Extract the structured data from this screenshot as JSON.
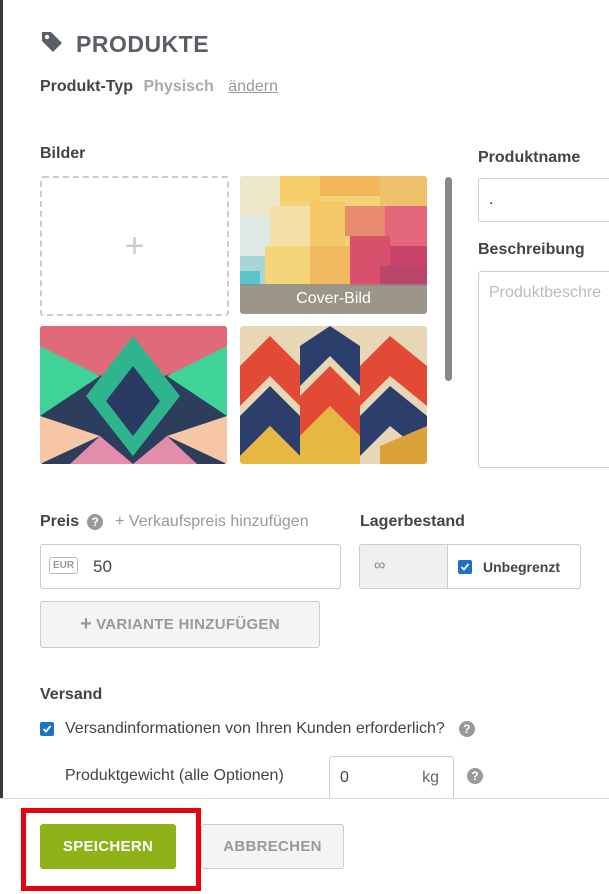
{
  "header": {
    "title": "PRODUKTE",
    "icon": "tag-icon"
  },
  "product_type": {
    "label": "Produkt-Typ",
    "value": "Physisch",
    "change_link": "ändern"
  },
  "images": {
    "label": "Bilder",
    "add_icon": "+",
    "cover_label": "Cover-Bild"
  },
  "product_name": {
    "label": "Produktname",
    "value": "."
  },
  "description": {
    "label": "Beschreibung",
    "placeholder": "Produktbeschre"
  },
  "price": {
    "label": "Preis",
    "add_sale_price": "+ Verkaufspreis hinzufügen",
    "currency": "EUR",
    "value": "50"
  },
  "stock": {
    "label": "Lagerbestand",
    "value": "∞",
    "unlimited_label": "Unbegrenzt",
    "unlimited_checked": true
  },
  "variant_button": {
    "label": "VARIANTE HINZUFÜGEN",
    "plus": "+"
  },
  "shipping": {
    "label": "Versand",
    "require_info_label": "Versandinformationen von Ihren Kunden erforderlich?",
    "require_info_checked": true,
    "weight_label": "Produktgewicht (alle Optionen)",
    "weight_value": "0",
    "weight_unit": "kg"
  },
  "footer": {
    "save_label": "SPEICHERN",
    "cancel_label": "ABBRECHEN"
  },
  "colors": {
    "accent_green": "#8db319",
    "highlight_red": "#e8000d",
    "checkbox_blue": "#1a73c8"
  }
}
